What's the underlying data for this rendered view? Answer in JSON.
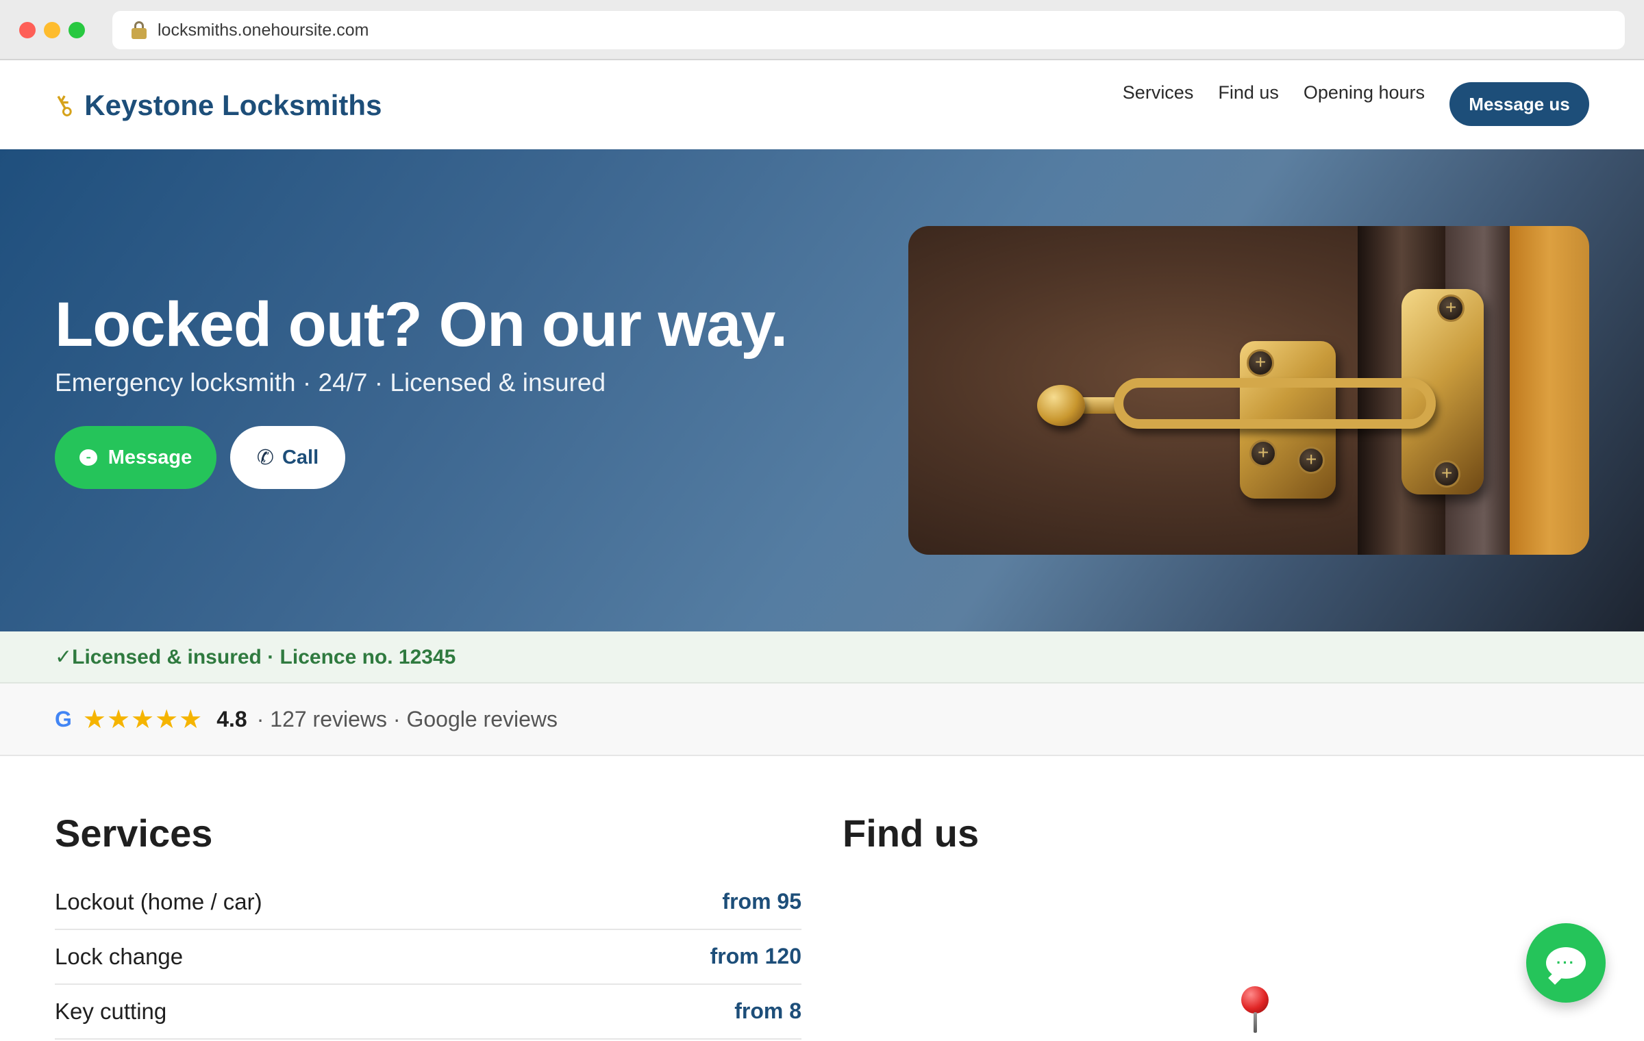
{
  "browser": {
    "url": "locksmiths.onehoursite.com",
    "icons": {
      "secure": "lock-icon"
    }
  },
  "header": {
    "brand_name": "Keystone Locksmiths",
    "brand_icon": "key-icon",
    "nav": [
      "Services",
      "Find us",
      "Opening hours"
    ],
    "cta_label": "Message us"
  },
  "hero": {
    "title": "Locked out? On our way.",
    "subtitle": "Emergency locksmith · 24/7 · Licensed & insured",
    "message_label": "Message",
    "call_label": "Call",
    "image": "door-chain-lock-photo"
  },
  "licence": {
    "text": "Licensed & insured · Licence no. 12345",
    "icon": "checkmark-icon"
  },
  "reviews": {
    "provider_icon": "google-g-icon",
    "stars": "★★★★★",
    "rating": "4.8",
    "meta": "· 127 reviews · Google reviews"
  },
  "services": {
    "title": "Services",
    "items": [
      {
        "name": "Lockout (home / car)",
        "price": "from 95"
      },
      {
        "name": "Lock change",
        "price": "from 120"
      },
      {
        "name": "Key cutting",
        "price": "from 8"
      }
    ]
  },
  "find_us": {
    "title": "Find us",
    "map_icon": "map-pin-icon"
  },
  "chat": {
    "icon": "chat-bubble-icon"
  },
  "colors": {
    "brand": "#1d4e79",
    "whatsapp_green": "#25c45a",
    "licence_green": "#2f7a3f",
    "star": "#f5b400"
  }
}
